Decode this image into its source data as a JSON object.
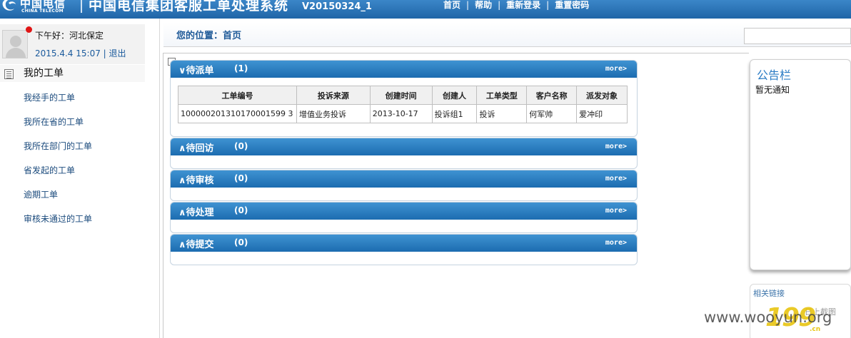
{
  "header": {
    "logo_cn": "中国电信",
    "logo_en": "CHINA TELECOM",
    "title": "中国电信集团客服工单处理系统",
    "version": "V20150324_1",
    "nav": [
      {
        "label": "首页"
      },
      {
        "label": "帮助"
      },
      {
        "label": "重新登录"
      },
      {
        "label": "重置密码"
      }
    ],
    "nav_separator": "|"
  },
  "user": {
    "greeting": "下午好：河北保定",
    "datetime": "2015.4.4 15:07",
    "separator": "|",
    "logout_label": "退出"
  },
  "sidebar": {
    "section_title": "我的工单",
    "items": [
      {
        "label": "我经手的工单"
      },
      {
        "label": "我所在省的工单"
      },
      {
        "label": "我所在部门的工单"
      },
      {
        "label": "省发起的工单"
      },
      {
        "label": "逾期工单"
      },
      {
        "label": "审核未通过的工单"
      }
    ]
  },
  "breadcrumb": {
    "text": "您的位置：首页"
  },
  "panels": [
    {
      "title": "∨待派单",
      "count": "(1)",
      "more": "more>"
    },
    {
      "title": "∧待回访",
      "count": "(0)",
      "more": "more>"
    },
    {
      "title": "∧待审核",
      "count": "(0)",
      "more": "more>"
    },
    {
      "title": "∧待处理",
      "count": "(0)",
      "more": "more>"
    },
    {
      "title": "∧待提交",
      "count": "(0)",
      "more": "more>"
    }
  ],
  "orders_table": {
    "columns": [
      "工单编号",
      "投诉来源",
      "创建时间",
      "创建人",
      "工单类型",
      "客户名称",
      "派发对象"
    ],
    "rows": [
      [
        "100000201310170001599 3",
        "增值业务投诉",
        "2013-10-17",
        "投诉组1",
        "投诉",
        "何军帅",
        "爱冲印"
      ]
    ]
  },
  "notice": {
    "title": "公告栏",
    "body": "暂无通知"
  },
  "links": {
    "title": "相关链接",
    "content": "日上截图"
  },
  "watermark": {
    "logo": "199",
    "logo_sub": ".cn",
    "text": "www.wooyun.org"
  },
  "colors": {
    "header_blue": "#1f65a7",
    "panel_blue": "#1c6cb0",
    "link_blue": "#1a5a9c",
    "online_red": "#e01515"
  }
}
